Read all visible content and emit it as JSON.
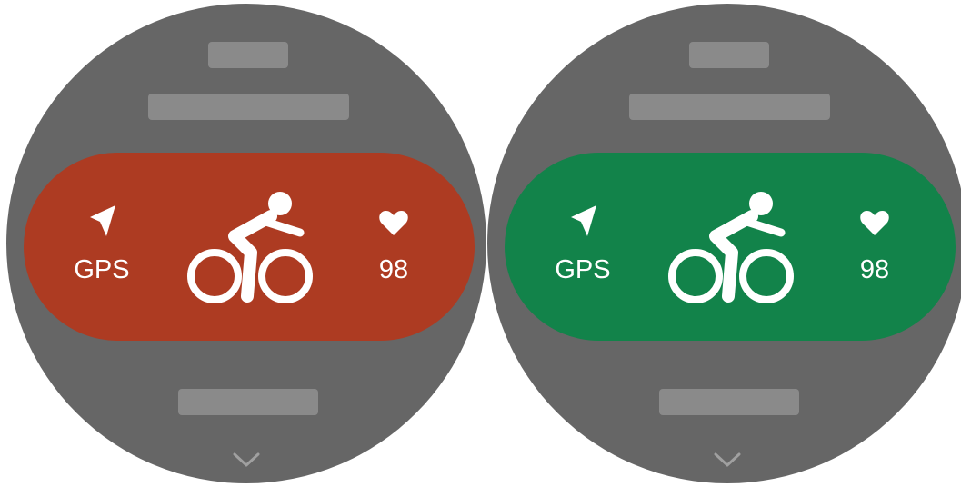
{
  "watches": [
    {
      "state": "red",
      "pill_color": "#ad3b22",
      "gps": {
        "icon": "navigation-arrow-icon",
        "label": "GPS"
      },
      "activity": {
        "icon": "cycling-icon"
      },
      "heart_rate": {
        "icon": "heart-icon",
        "value": "98"
      },
      "more": {
        "icon": "chevron-down-icon"
      }
    },
    {
      "state": "green",
      "pill_color": "#12834a",
      "gps": {
        "icon": "navigation-arrow-icon",
        "label": "GPS"
      },
      "activity": {
        "icon": "cycling-icon"
      },
      "heart_rate": {
        "icon": "heart-icon",
        "value": "98"
      },
      "more": {
        "icon": "chevron-down-icon"
      }
    }
  ],
  "colors": {
    "watch_background": "#666666",
    "placeholder": "#8a8a8a",
    "foreground": "#ffffff",
    "chevron": "#a0a0a0"
  }
}
